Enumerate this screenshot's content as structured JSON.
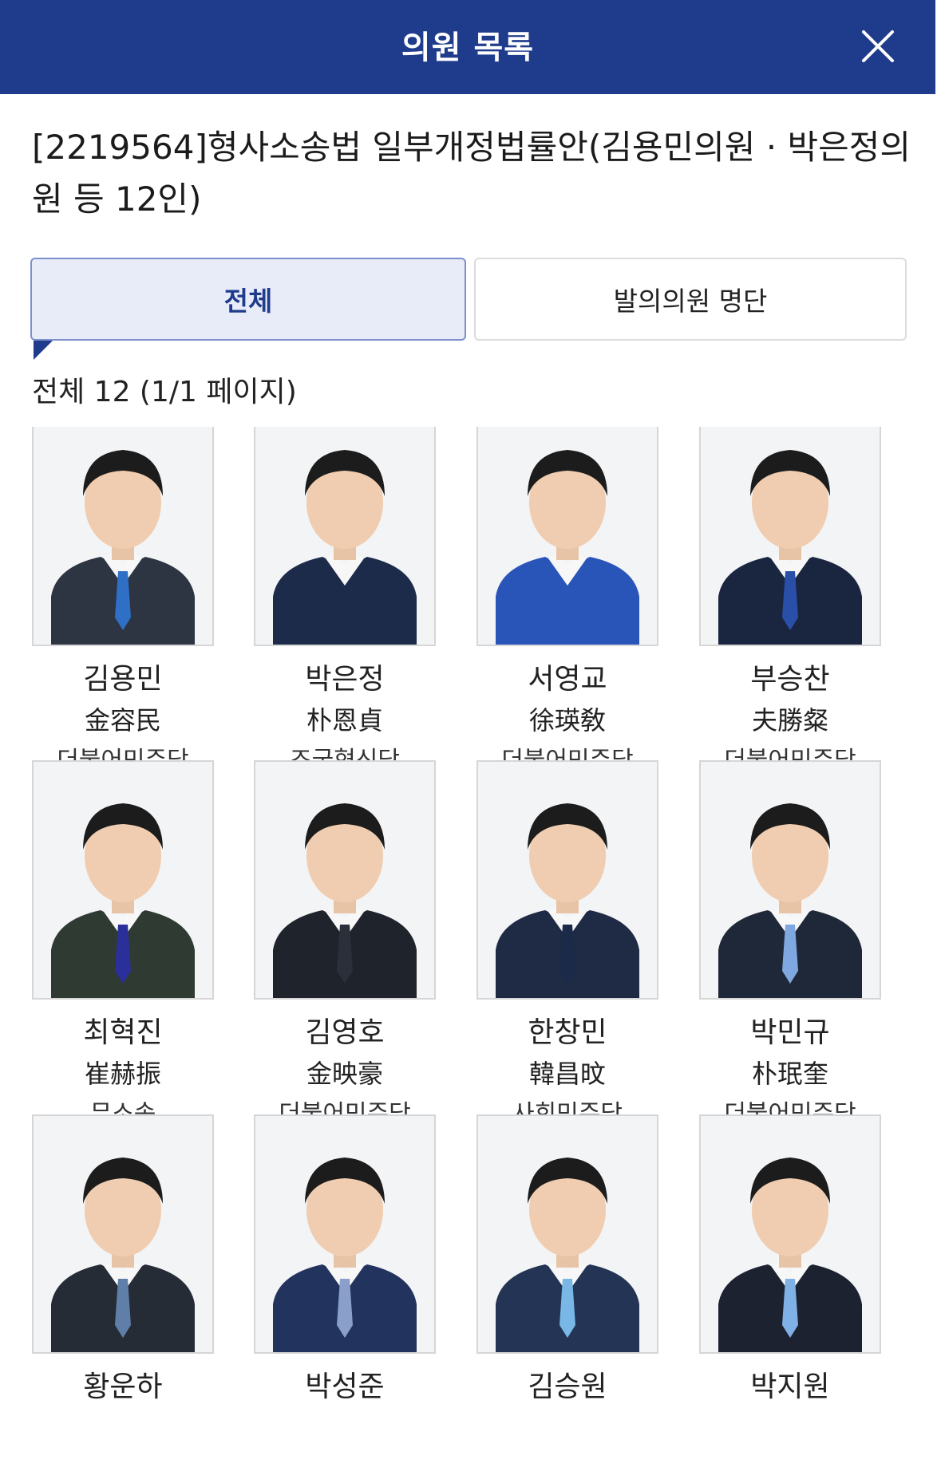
{
  "header": {
    "title": "의원 목록",
    "close_icon": "close-icon"
  },
  "bill": {
    "title": "[2219564]형사소송법 일부개정법률안(김용민의원 · 박은정의원 등 12인)"
  },
  "tabs": [
    {
      "label": "전체",
      "active": true
    },
    {
      "label": "발의의원 명단",
      "active": false
    }
  ],
  "summary": {
    "text": "전체 12 (1/1 페이지)"
  },
  "colors": {
    "header_bg": "#1f3b8c",
    "active_tab_bg": "#e8ecf8",
    "active_tab_border": "#7d8fcc"
  },
  "members": [
    {
      "name": "김용민",
      "hanja": "金容民",
      "party": "더불어민주당",
      "tie": "#2f6fc6",
      "jacket": "#2d3442"
    },
    {
      "name": "박은정",
      "hanja": "朴恩貞",
      "party": "조국혁신당",
      "tie": "",
      "jacket": "#1d2b4a"
    },
    {
      "name": "서영교",
      "hanja": "徐瑛敎",
      "party": "더불어민주당",
      "tie": "",
      "jacket": "#2a55b8"
    },
    {
      "name": "부승찬",
      "hanja": "夫勝粲",
      "party": "더불어민주당",
      "tie": "#2a4fa8",
      "jacket": "#1a2540"
    },
    {
      "name": "최혁진",
      "hanja": "崔赫振",
      "party": "무소속",
      "tie": "#2a2f9a",
      "jacket": "#2f3a32"
    },
    {
      "name": "김영호",
      "hanja": "金映豪",
      "party": "더불어민주당",
      "tie": "#2a2f3a",
      "jacket": "#1e232c"
    },
    {
      "name": "한창민",
      "hanja": "韓昌旼",
      "party": "사회민주당",
      "tie": "#1c2a4a",
      "jacket": "#1f2a44"
    },
    {
      "name": "박민규",
      "hanja": "朴珉奎",
      "party": "더불어민주당",
      "tie": "#7fa7e0",
      "jacket": "#1f2838"
    },
    {
      "name": "황운하",
      "hanja": "",
      "party": "",
      "tie": "#5f7fa8",
      "jacket": "#262c36"
    },
    {
      "name": "박성준",
      "hanja": "",
      "party": "",
      "tie": "#8a9fc9",
      "jacket": "#22335e"
    },
    {
      "name": "김승원",
      "hanja": "",
      "party": "",
      "tie": "#79b7e6",
      "jacket": "#233454"
    },
    {
      "name": "박지원",
      "hanja": "",
      "party": "",
      "tie": "#7fb0e6",
      "jacket": "#1c2230"
    }
  ]
}
